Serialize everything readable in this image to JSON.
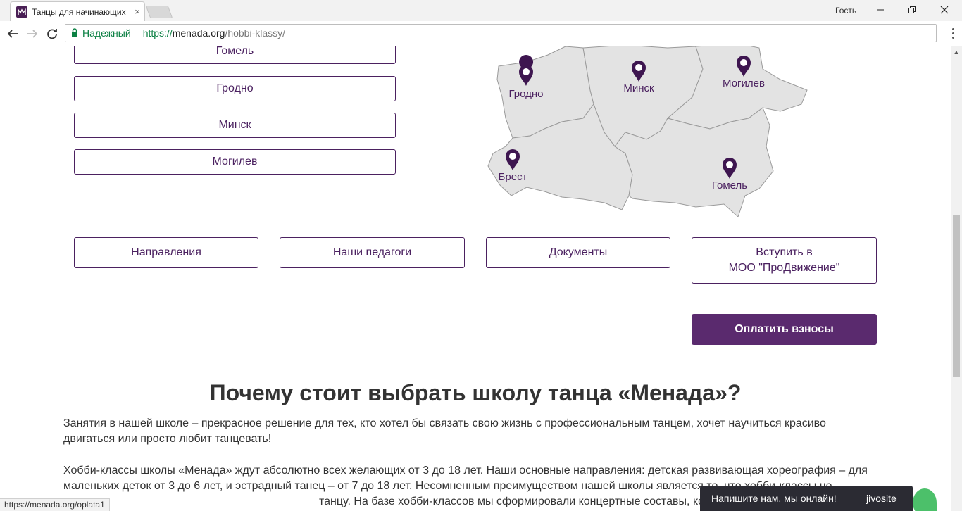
{
  "browser": {
    "tab_title": "Танцы для начинающих",
    "tab_close": "×",
    "profile": "Гость",
    "secure_label": "Надежный",
    "url_scheme": "https://",
    "url_host": "menada.org",
    "url_path": "/hobbi-klassy/"
  },
  "regions": {
    "buttons": [
      "Гомель",
      "Гродно",
      "Минск",
      "Могилев"
    ],
    "map_cities": [
      "Гродно",
      "Минск",
      "Могилев",
      "Брест",
      "Гомель"
    ]
  },
  "nav": {
    "directions": "Направления",
    "teachers": "Наши педагоги",
    "documents": "Документы",
    "join_line1": "Вступить в",
    "join_line2": "МОО \"ПроДвижение\"",
    "pay": "Оплатить взносы"
  },
  "content": {
    "title": "Почему стоит выбрать школу танца «Менада»?",
    "p1": "Занятия в нашей школе – прекрасное решение для тех, кто хотел бы связать свою жизнь с профессиональным танцем, хочет научиться красиво двигаться или просто любит танцевать!",
    "p2_line1": "Хобби-классы школы «Менада» ждут абсолютно всех желающих от 3 до 18 лет. Наши основные направления: детская развивающая хореография – для",
    "p2_line2": "маленьких деток от 3 до 6 лет, и эстрадный танец – от 7 до 18 лет. Несомненным преимуществом нашей школы является то, что хобби-классы не",
    "p2_line3": "танцу. На базе хобби-классов мы сформировали концертные составы, кот"
  },
  "status": {
    "hover_url": "https://menada.org/oplata1"
  },
  "chat": {
    "text": "Напишите нам, мы онлайн!",
    "brand": "jivosite"
  },
  "colors": {
    "brand_purple": "#4b2160",
    "pay_button": "#5a2a6e",
    "map_fill": "#e3e3e3"
  }
}
